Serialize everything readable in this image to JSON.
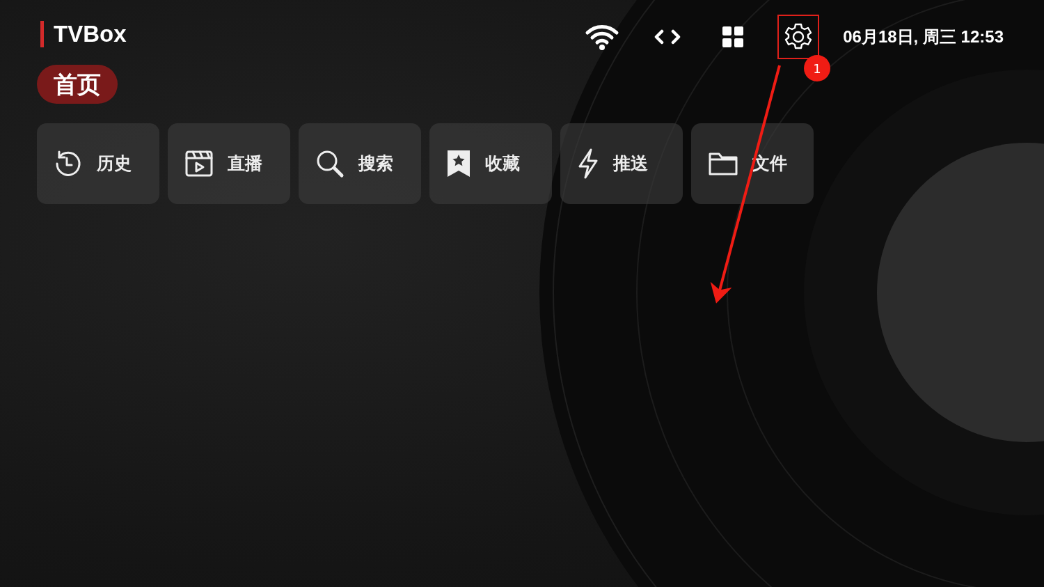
{
  "brand": {
    "title": "TVBox"
  },
  "tabs": [
    {
      "label": "首页",
      "selected": true
    }
  ],
  "toolbar": [
    {
      "kind": "wifi",
      "highlighted": false
    },
    {
      "kind": "code",
      "highlighted": false
    },
    {
      "kind": "grid",
      "highlighted": false
    },
    {
      "kind": "settings",
      "highlighted": true
    }
  ],
  "datetime": "06月18日, 周三 12:53",
  "tiles": [
    {
      "kind": "history",
      "label": "历史"
    },
    {
      "kind": "live",
      "label": "直播"
    },
    {
      "kind": "search",
      "label": "搜索"
    },
    {
      "kind": "favorite",
      "label": "收藏"
    },
    {
      "kind": "push",
      "label": "推送"
    },
    {
      "kind": "folder",
      "label": "文件"
    }
  ],
  "annotation": {
    "step": "1"
  }
}
